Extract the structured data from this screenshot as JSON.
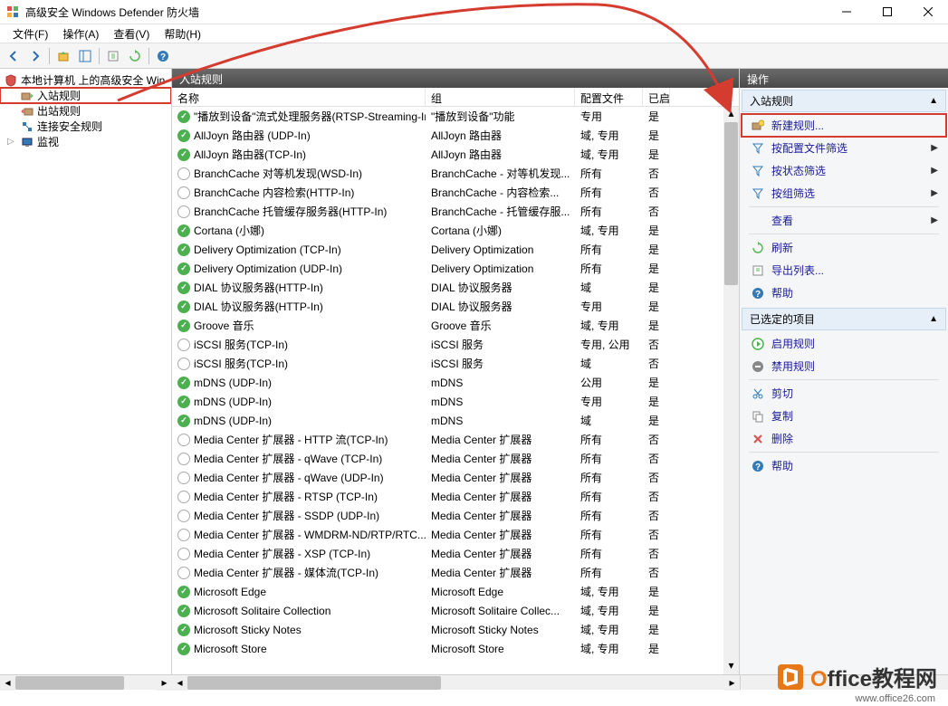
{
  "window": {
    "title": "高级安全 Windows Defender 防火墙"
  },
  "menubar": {
    "file": "文件(F)",
    "action": "操作(A)",
    "view": "查看(V)",
    "help": "帮助(H)"
  },
  "tree": {
    "root": "本地计算机 上的高级安全 Win",
    "inbound": "入站规则",
    "outbound": "出站规则",
    "connection": "连接安全规则",
    "monitor": "监视"
  },
  "center": {
    "title": "入站规则",
    "columns": {
      "name": "名称",
      "group": "组",
      "profile": "配置文件",
      "enabled": "已启"
    },
    "rules": [
      {
        "enabled": true,
        "name": "\"播放到设备\"流式处理服务器(RTSP-Streaming-In)",
        "group": "\"播放到设备\"功能",
        "profile": "专用",
        "en": "是"
      },
      {
        "enabled": true,
        "name": "AllJoyn 路由器 (UDP-In)",
        "group": "AllJoyn 路由器",
        "profile": "域, 专用",
        "en": "是"
      },
      {
        "enabled": true,
        "name": "AllJoyn 路由器(TCP-In)",
        "group": "AllJoyn 路由器",
        "profile": "域, 专用",
        "en": "是"
      },
      {
        "enabled": false,
        "name": "BranchCache 对等机发现(WSD-In)",
        "group": "BranchCache - 对等机发现...",
        "profile": "所有",
        "en": "否"
      },
      {
        "enabled": false,
        "name": "BranchCache 内容检索(HTTP-In)",
        "group": "BranchCache - 内容检索...",
        "profile": "所有",
        "en": "否"
      },
      {
        "enabled": false,
        "name": "BranchCache 托管缓存服务器(HTTP-In)",
        "group": "BranchCache - 托管缓存服...",
        "profile": "所有",
        "en": "否"
      },
      {
        "enabled": true,
        "name": "Cortana (小娜)",
        "group": "Cortana (小娜)",
        "profile": "域, 专用",
        "en": "是"
      },
      {
        "enabled": true,
        "name": "Delivery Optimization (TCP-In)",
        "group": "Delivery Optimization",
        "profile": "所有",
        "en": "是"
      },
      {
        "enabled": true,
        "name": "Delivery Optimization (UDP-In)",
        "group": "Delivery Optimization",
        "profile": "所有",
        "en": "是"
      },
      {
        "enabled": true,
        "name": "DIAL 协议服务器(HTTP-In)",
        "group": "DIAL 协议服务器",
        "profile": "域",
        "en": "是"
      },
      {
        "enabled": true,
        "name": "DIAL 协议服务器(HTTP-In)",
        "group": "DIAL 协议服务器",
        "profile": "专用",
        "en": "是"
      },
      {
        "enabled": true,
        "name": "Groove 音乐",
        "group": "Groove 音乐",
        "profile": "域, 专用",
        "en": "是"
      },
      {
        "enabled": false,
        "name": "iSCSI 服务(TCP-In)",
        "group": "iSCSI 服务",
        "profile": "专用, 公用",
        "en": "否"
      },
      {
        "enabled": false,
        "name": "iSCSI 服务(TCP-In)",
        "group": "iSCSI 服务",
        "profile": "域",
        "en": "否"
      },
      {
        "enabled": true,
        "name": "mDNS (UDP-In)",
        "group": "mDNS",
        "profile": "公用",
        "en": "是"
      },
      {
        "enabled": true,
        "name": "mDNS (UDP-In)",
        "group": "mDNS",
        "profile": "专用",
        "en": "是"
      },
      {
        "enabled": true,
        "name": "mDNS (UDP-In)",
        "group": "mDNS",
        "profile": "域",
        "en": "是"
      },
      {
        "enabled": false,
        "name": "Media Center 扩展器 - HTTP 流(TCP-In)",
        "group": "Media Center 扩展器",
        "profile": "所有",
        "en": "否"
      },
      {
        "enabled": false,
        "name": "Media Center 扩展器 - qWave (TCP-In)",
        "group": "Media Center 扩展器",
        "profile": "所有",
        "en": "否"
      },
      {
        "enabled": false,
        "name": "Media Center 扩展器 - qWave (UDP-In)",
        "group": "Media Center 扩展器",
        "profile": "所有",
        "en": "否"
      },
      {
        "enabled": false,
        "name": "Media Center 扩展器 - RTSP (TCP-In)",
        "group": "Media Center 扩展器",
        "profile": "所有",
        "en": "否"
      },
      {
        "enabled": false,
        "name": "Media Center 扩展器 - SSDP (UDP-In)",
        "group": "Media Center 扩展器",
        "profile": "所有",
        "en": "否"
      },
      {
        "enabled": false,
        "name": "Media Center 扩展器 - WMDRM-ND/RTP/RTC...",
        "group": "Media Center 扩展器",
        "profile": "所有",
        "en": "否"
      },
      {
        "enabled": false,
        "name": "Media Center 扩展器 - XSP (TCP-In)",
        "group": "Media Center 扩展器",
        "profile": "所有",
        "en": "否"
      },
      {
        "enabled": false,
        "name": "Media Center 扩展器 - 媒体流(TCP-In)",
        "group": "Media Center 扩展器",
        "profile": "所有",
        "en": "否"
      },
      {
        "enabled": true,
        "name": "Microsoft Edge",
        "group": "Microsoft Edge",
        "profile": "域, 专用",
        "en": "是"
      },
      {
        "enabled": true,
        "name": "Microsoft Solitaire Collection",
        "group": "Microsoft Solitaire Collec...",
        "profile": "域, 专用",
        "en": "是"
      },
      {
        "enabled": true,
        "name": "Microsoft Sticky Notes",
        "group": "Microsoft Sticky Notes",
        "profile": "域, 专用",
        "en": "是"
      },
      {
        "enabled": true,
        "name": "Microsoft Store",
        "group": "Microsoft Store",
        "profile": "域, 专用",
        "en": "是"
      }
    ]
  },
  "actions": {
    "title": "操作",
    "section1": "入站规则",
    "new_rule": "新建规则...",
    "filter_profile": "按配置文件筛选",
    "filter_state": "按状态筛选",
    "filter_group": "按组筛选",
    "view": "查看",
    "refresh": "刷新",
    "export": "导出列表...",
    "help": "帮助",
    "section2": "已选定的项目",
    "enable_rule": "启用规则",
    "disable_rule": "禁用规则",
    "cut": "剪切",
    "copy": "复制",
    "delete": "删除",
    "help2": "帮助"
  },
  "watermark": {
    "text": "Office教程网",
    "url": "www.office26.com"
  }
}
